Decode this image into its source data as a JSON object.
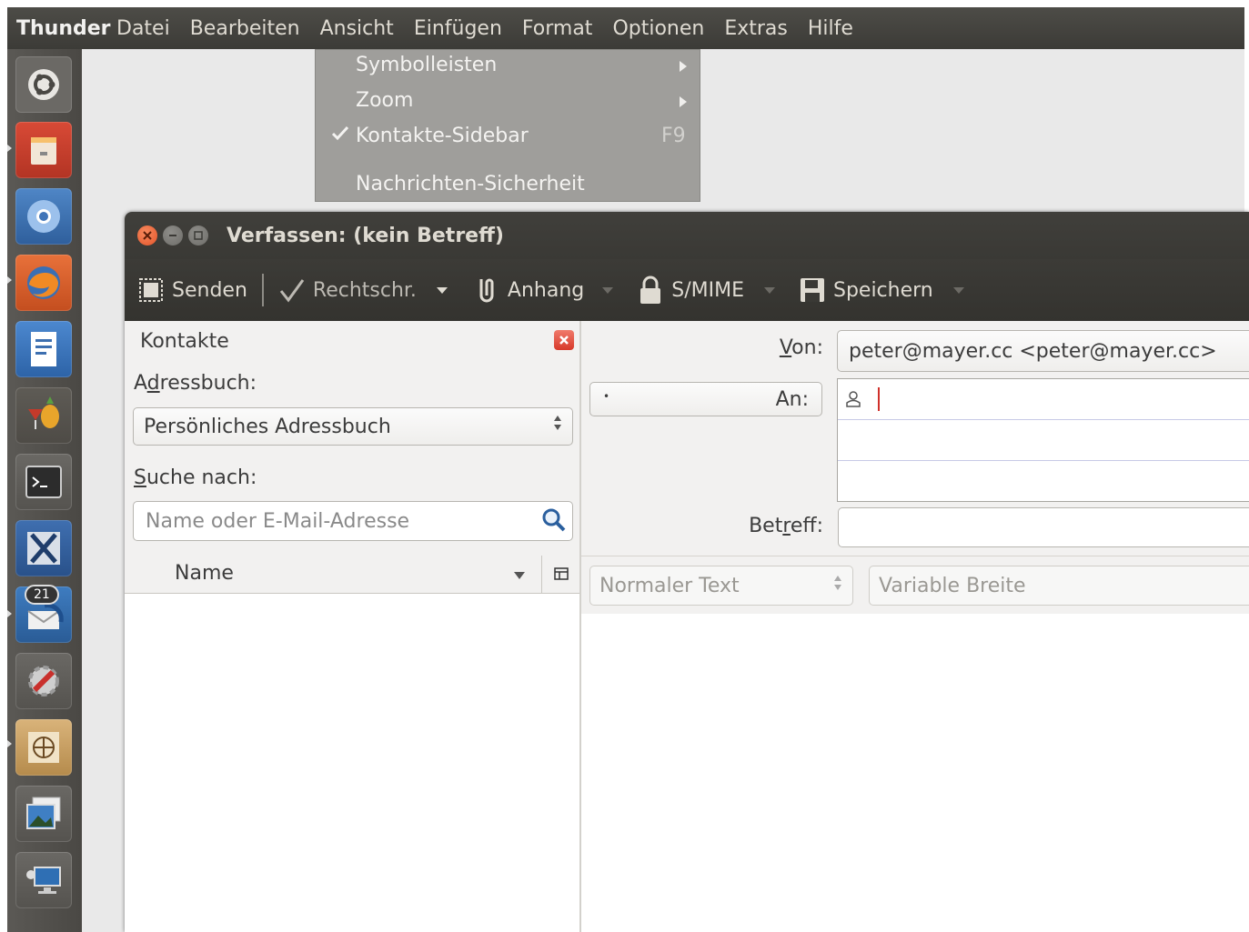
{
  "top_panel": {
    "app_title": "Thunder",
    "menu": [
      "Datei",
      "Bearbeiten",
      "Ansicht",
      "Einfügen",
      "Format",
      "Optionen",
      "Extras",
      "Hilfe"
    ]
  },
  "dropdown": {
    "items": [
      {
        "label": "Symbolleisten",
        "submenu": true
      },
      {
        "label": "Zoom",
        "submenu": true
      },
      {
        "label": "Kontakte-Sidebar",
        "checked": true,
        "shortcut": "F9"
      },
      {
        "label": "Nachrichten-Sicherheit"
      }
    ]
  },
  "launcher": {
    "items": [
      "ubuntu-dash",
      "files",
      "chromium",
      "firefox",
      "libreoffice-writer",
      "cocktail-app",
      "terminal",
      "x-app",
      "thunderbird",
      "system-settings",
      "gimp-like-app",
      "image-viewer",
      "remote-desktop"
    ],
    "thunderbird_badge": "21"
  },
  "compose": {
    "title": "Verfassen: (kein Betreff)",
    "toolbar": {
      "send": "Senden",
      "spell": "Rechtschr.",
      "attach": "Anhang",
      "smime": "S/MIME",
      "save": "Speichern"
    },
    "sidebar": {
      "title": "Kontakte",
      "addressbook_label_pre": "A",
      "addressbook_label_u": "d",
      "addressbook_label_post": "ressbuch:",
      "addressbook_value": "Persönliches Adressbuch",
      "search_label_u": "S",
      "search_label_post": "uche nach:",
      "search_placeholder": "Name oder E-Mail-Adresse",
      "column_name": "Name"
    },
    "fields": {
      "from_label_u": "V",
      "from_label_post": "on:",
      "from_value": "peter@mayer.cc <peter@mayer.cc>",
      "to_label": "An:",
      "subject_label_pre": "Bet",
      "subject_label_u": "r",
      "subject_label_post": "eff:"
    },
    "format": {
      "paragraph": "Normaler Text",
      "font": "Variable Breite"
    }
  },
  "colors": {
    "panel": "#3c3b37",
    "menu_bg": "#9f9e9b",
    "close_button": "#e3542a"
  }
}
